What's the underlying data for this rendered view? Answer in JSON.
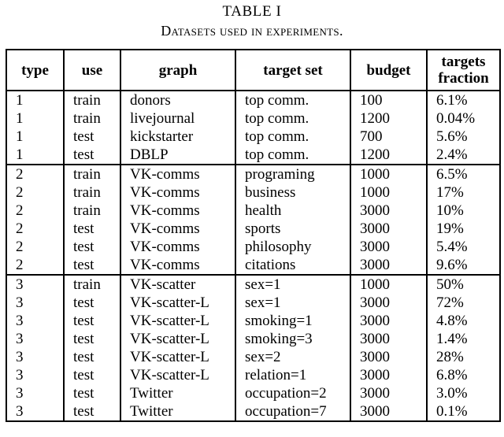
{
  "caption": {
    "number": "TABLE I",
    "title": "Datasets used in experiments."
  },
  "table": {
    "columns": [
      {
        "key": "type",
        "label": "type"
      },
      {
        "key": "use",
        "label": "use"
      },
      {
        "key": "graph",
        "label": "graph"
      },
      {
        "key": "target",
        "label": "target  set"
      },
      {
        "key": "budget",
        "label": "budget"
      },
      {
        "key": "fraction",
        "label_line1": "targets",
        "label_line2": "fraction"
      }
    ],
    "blocks": [
      {
        "type_group": "1",
        "rows": [
          {
            "type": "1",
            "use": "train",
            "graph": "donors",
            "target": "top  comm.",
            "budget": "100",
            "fraction": "6.1%"
          },
          {
            "type": "1",
            "use": "train",
            "graph": "livejournal",
            "target": "top  comm.",
            "budget": "1200",
            "fraction": "0.04%"
          },
          {
            "type": "1",
            "use": "test",
            "graph": "kickstarter",
            "target": "top  comm.",
            "budget": "700",
            "fraction": "5.6%"
          },
          {
            "type": "1",
            "use": "test",
            "graph": "DBLP",
            "target": "top  comm.",
            "budget": "1200",
            "fraction": "2.4%"
          }
        ]
      },
      {
        "type_group": "2",
        "rows": [
          {
            "type": "2",
            "use": "train",
            "graph": "VK-comms",
            "target": "programing",
            "budget": "1000",
            "fraction": "6.5%"
          },
          {
            "type": "2",
            "use": "train",
            "graph": "VK-comms",
            "target": "business",
            "budget": "1000",
            "fraction": "17%"
          },
          {
            "type": "2",
            "use": "train",
            "graph": "VK-comms",
            "target": "health",
            "budget": "3000",
            "fraction": "10%"
          },
          {
            "type": "2",
            "use": "test",
            "graph": "VK-comms",
            "target": "sports",
            "budget": "3000",
            "fraction": "19%"
          },
          {
            "type": "2",
            "use": "test",
            "graph": "VK-comms",
            "target": "philosophy",
            "budget": "3000",
            "fraction": "5.4%"
          },
          {
            "type": "2",
            "use": "test",
            "graph": "VK-comms",
            "target": "citations",
            "budget": "3000",
            "fraction": "9.6%"
          }
        ]
      },
      {
        "type_group": "3",
        "rows": [
          {
            "type": "3",
            "use": "train",
            "graph": "VK-scatter",
            "target": "sex=1",
            "budget": "1000",
            "fraction": "50%"
          },
          {
            "type": "3",
            "use": "test",
            "graph": "VK-scatter-L",
            "target": "sex=1",
            "budget": "3000",
            "fraction": "72%"
          },
          {
            "type": "3",
            "use": "test",
            "graph": "VK-scatter-L",
            "target": "smoking=1",
            "budget": "3000",
            "fraction": "4.8%"
          },
          {
            "type": "3",
            "use": "test",
            "graph": "VK-scatter-L",
            "target": "smoking=3",
            "budget": "3000",
            "fraction": "1.4%"
          },
          {
            "type": "3",
            "use": "test",
            "graph": "VK-scatter-L",
            "target": "sex=2",
            "budget": "3000",
            "fraction": "28%"
          },
          {
            "type": "3",
            "use": "test",
            "graph": "VK-scatter-L",
            "target": "relation=1",
            "budget": "3000",
            "fraction": "6.8%"
          },
          {
            "type": "3",
            "use": "test",
            "graph": "Twitter",
            "target": "occupation=2",
            "budget": "3000",
            "fraction": "3.0%"
          },
          {
            "type": "3",
            "use": "test",
            "graph": "Twitter",
            "target": "occupation=7",
            "budget": "3000",
            "fraction": "0.1%"
          }
        ]
      }
    ]
  }
}
